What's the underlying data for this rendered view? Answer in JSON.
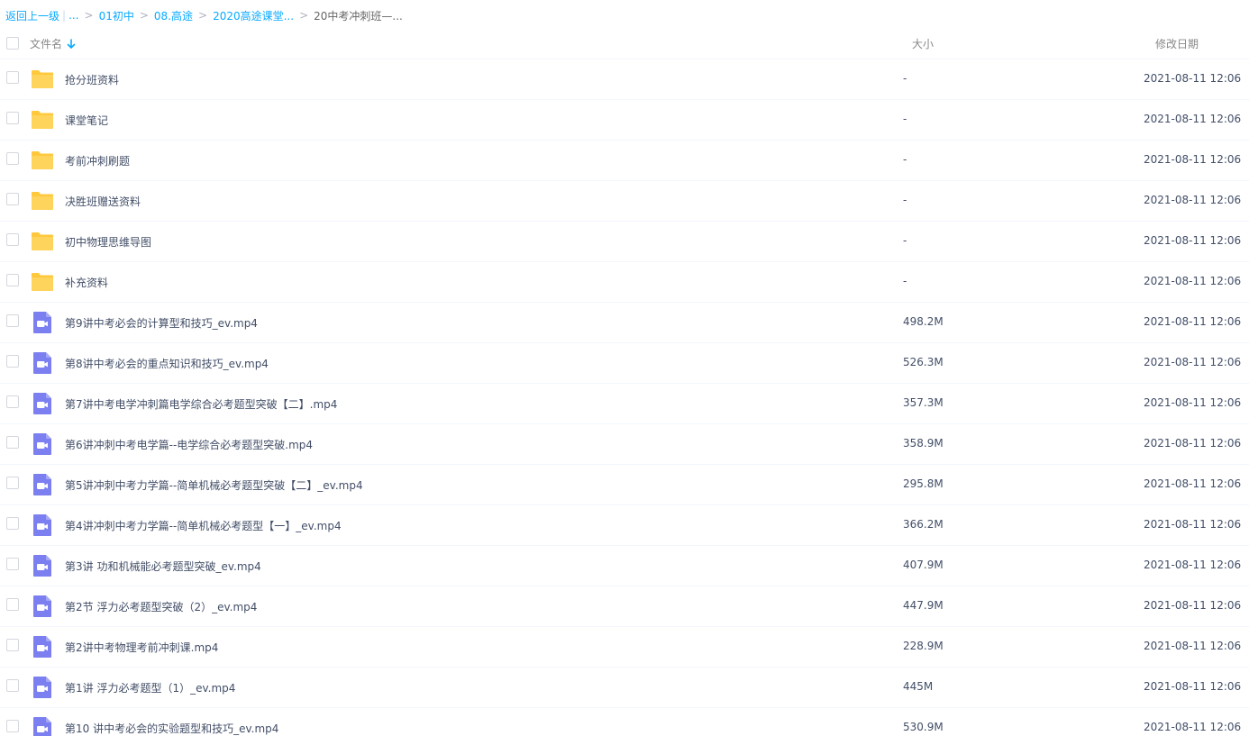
{
  "breadcrumb": {
    "back": "返回上一级",
    "bar": "|",
    "ellipsis": "...",
    "items": [
      "01初中",
      "08.高途",
      "2020高途课堂..."
    ],
    "current": "20中考冲刺班—...",
    "sep": ">"
  },
  "header": {
    "name": "文件名",
    "size": "大小",
    "date": "修改日期"
  },
  "colors": {
    "link": "#09aaff",
    "folder": "#ffd45c",
    "video": "#7b7ff0"
  },
  "files": [
    {
      "type": "folder-icon",
      "name": "抢分班资料",
      "size": "-",
      "date": "2021-08-11 12:06"
    },
    {
      "type": "folder-icon",
      "name": "课堂笔记",
      "size": "-",
      "date": "2021-08-11 12:06"
    },
    {
      "type": "folder-icon",
      "name": "考前冲刺刷题",
      "size": "-",
      "date": "2021-08-11 12:06"
    },
    {
      "type": "folder-icon",
      "name": "决胜班赠送资料",
      "size": "-",
      "date": "2021-08-11 12:06"
    },
    {
      "type": "folder-icon",
      "name": "初中物理思维导图",
      "size": "-",
      "date": "2021-08-11 12:06"
    },
    {
      "type": "folder-icon",
      "name": "补充资料",
      "size": "-",
      "date": "2021-08-11 12:06"
    },
    {
      "type": "video-icon",
      "name": "第9讲中考必会的计算型和技巧_ev.mp4",
      "size": "498.2M",
      "date": "2021-08-11 12:06"
    },
    {
      "type": "video-icon",
      "name": "第8讲中考必会的重点知识和技巧_ev.mp4",
      "size": "526.3M",
      "date": "2021-08-11 12:06"
    },
    {
      "type": "video-icon",
      "name": "第7讲中考电学冲刺篇电学综合必考题型突破【二】.mp4",
      "size": "357.3M",
      "date": "2021-08-11 12:06"
    },
    {
      "type": "video-icon",
      "name": "第6讲冲刺中考电学篇--电学综合必考题型突破.mp4",
      "size": "358.9M",
      "date": "2021-08-11 12:06"
    },
    {
      "type": "video-icon",
      "name": "第5讲冲刺中考力学篇--简单机械必考题型突破【二】_ev.mp4",
      "size": "295.8M",
      "date": "2021-08-11 12:06"
    },
    {
      "type": "video-icon",
      "name": "第4讲冲刺中考力学篇--简单机械必考题型【一】_ev.mp4",
      "size": "366.2M",
      "date": "2021-08-11 12:06"
    },
    {
      "type": "video-icon",
      "name": "第3讲 功和机械能必考题型突破_ev.mp4",
      "size": "407.9M",
      "date": "2021-08-11 12:06"
    },
    {
      "type": "video-icon",
      "name": "第2节 浮力必考题型突破（2）_ev.mp4",
      "size": "447.9M",
      "date": "2021-08-11 12:06"
    },
    {
      "type": "video-icon",
      "name": "第2讲中考物理考前冲刺课.mp4",
      "size": "228.9M",
      "date": "2021-08-11 12:06"
    },
    {
      "type": "video-icon",
      "name": "第1讲 浮力必考题型（1）_ev.mp4",
      "size": "445M",
      "date": "2021-08-11 12:06"
    },
    {
      "type": "video-icon",
      "name": "第10 讲中考必会的实验题型和技巧_ev.mp4",
      "size": "530.9M",
      "date": "2021-08-11 12:06"
    }
  ]
}
